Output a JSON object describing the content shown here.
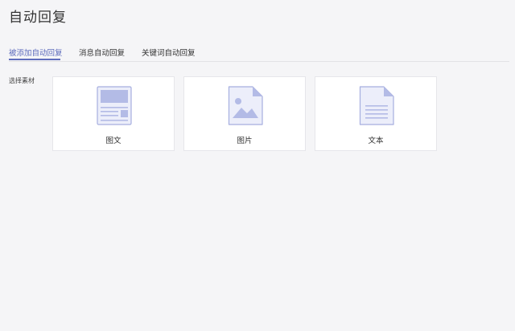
{
  "page": {
    "title": "自动回复"
  },
  "tabs": [
    {
      "label": "被添加自动回复",
      "active": true
    },
    {
      "label": "消息自动回复",
      "active": false
    },
    {
      "label": "关键词自动回复",
      "active": false
    }
  ],
  "material": {
    "label": "选择素材",
    "cards": [
      {
        "label": "图文",
        "icon": "article-icon"
      },
      {
        "label": "图片",
        "icon": "image-icon"
      },
      {
        "label": "文本",
        "icon": "text-document-icon"
      }
    ]
  },
  "colors": {
    "accent": "#5f6dbd",
    "icon_fill": "#eceefa",
    "icon_stroke": "#a6aedf",
    "icon_block": "#b3bbe6"
  }
}
